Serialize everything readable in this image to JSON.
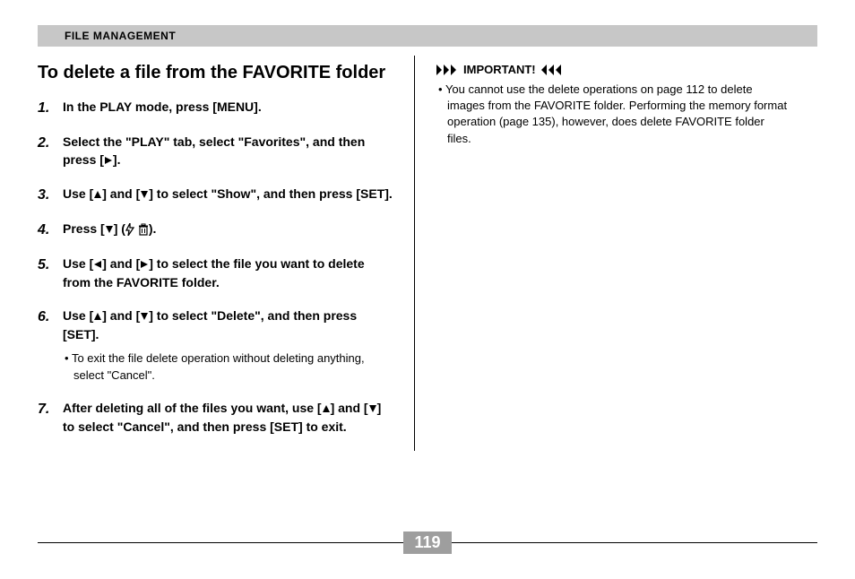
{
  "header": {
    "section_title": "FILE MANAGEMENT"
  },
  "left": {
    "title": "To delete a file from the FAVORITE folder",
    "steps": [
      {
        "num": "1.",
        "text_before": "In the PLAY mode, press [MENU].",
        "icons": []
      },
      {
        "num": "2.",
        "text_before": "Select the \"PLAY\" tab, select \"Favorites\", and then press [",
        "icons": [
          "right"
        ],
        "text_after": "]."
      },
      {
        "num": "3.",
        "text_before": "Use [",
        "seq": [
          "up",
          "] and [",
          "down",
          "] to select \"Show\", and then press [SET]."
        ]
      },
      {
        "num": "4.",
        "text_before": "Press [",
        "seq": [
          "down",
          "] (",
          "flash",
          " ",
          "trash",
          ")."
        ]
      },
      {
        "num": "5.",
        "text_before": "Use [",
        "seq": [
          "left",
          "] and [",
          "right",
          "] to select the file you want to delete from the FAVORITE folder."
        ]
      },
      {
        "num": "6.",
        "text_before": "Use [",
        "seq": [
          "up",
          "] and [",
          "down",
          "] to select \"Delete\", and then press [SET]."
        ],
        "sub": "To exit the file delete operation without deleting anything, select \"Cancel\"."
      },
      {
        "num": "7.",
        "text_before": "After deleting all of the files you want, use [",
        "seq": [
          "up",
          "] and [",
          "down",
          "] to select \"Cancel\", and then press [SET] to exit."
        ]
      }
    ]
  },
  "right": {
    "important_label": "IMPORTANT!",
    "note": "You cannot use the delete operations on page 112 to delete images from the FAVORITE folder. Performing the memory format operation (page 135), however, does delete FAVORITE folder files."
  },
  "page_number": "119"
}
